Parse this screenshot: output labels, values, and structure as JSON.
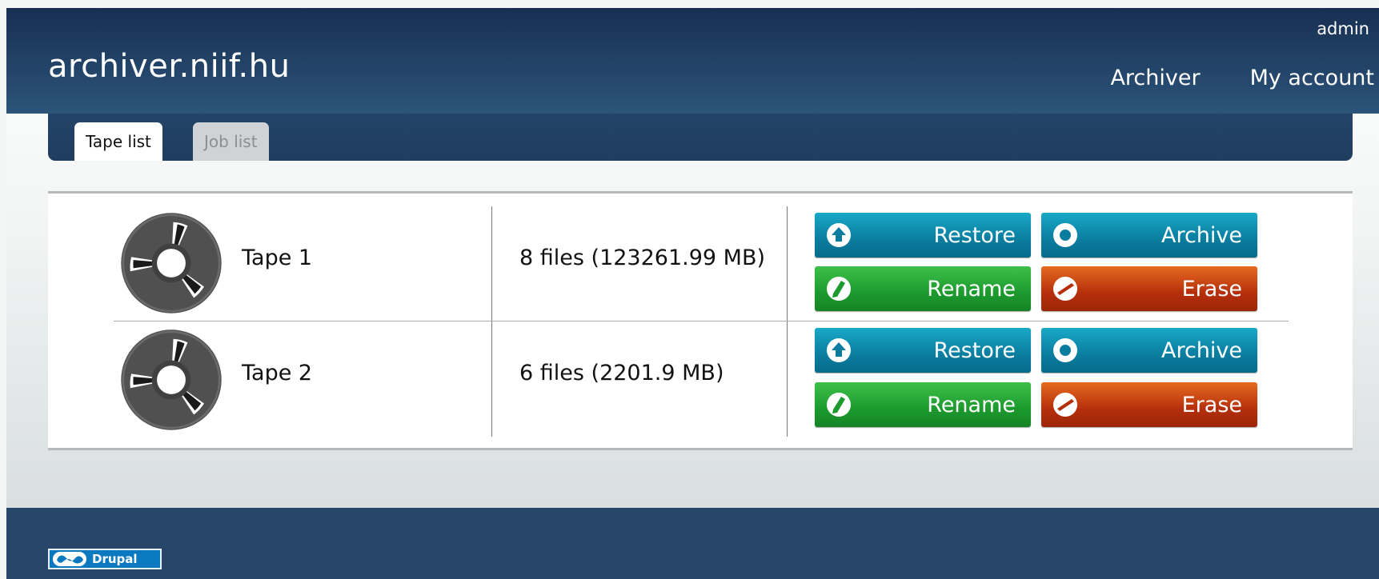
{
  "site": {
    "name": "archiver.niif.hu"
  },
  "user": {
    "name": "admin"
  },
  "menu": [
    {
      "label": "Archiver"
    },
    {
      "label": "My account"
    }
  ],
  "tabs": [
    {
      "label": "Tape list",
      "active": true
    },
    {
      "label": "Job list",
      "active": false
    }
  ],
  "tapes": [
    {
      "name": "Tape 1",
      "files": "8 files (123261.99 MB)"
    },
    {
      "name": "Tape 2",
      "files": "6 files (2201.9 MB)"
    }
  ],
  "actions": {
    "restore": "Restore",
    "archive": "Archive",
    "rename": "Rename",
    "erase": "Erase"
  },
  "icons": {
    "tape": "tape-reel-icon",
    "restore": "upload-arrow-icon",
    "archive": "ring-icon",
    "rename": "pencil-icon",
    "erase": "minus-icon"
  },
  "colors": {
    "header": "#1d3a5f",
    "footer": "#28456a",
    "restore": "#0a7d9f",
    "rename": "#1c9a2e",
    "erase": "#b52f0c"
  },
  "footer": {
    "badge": "Drupal"
  }
}
